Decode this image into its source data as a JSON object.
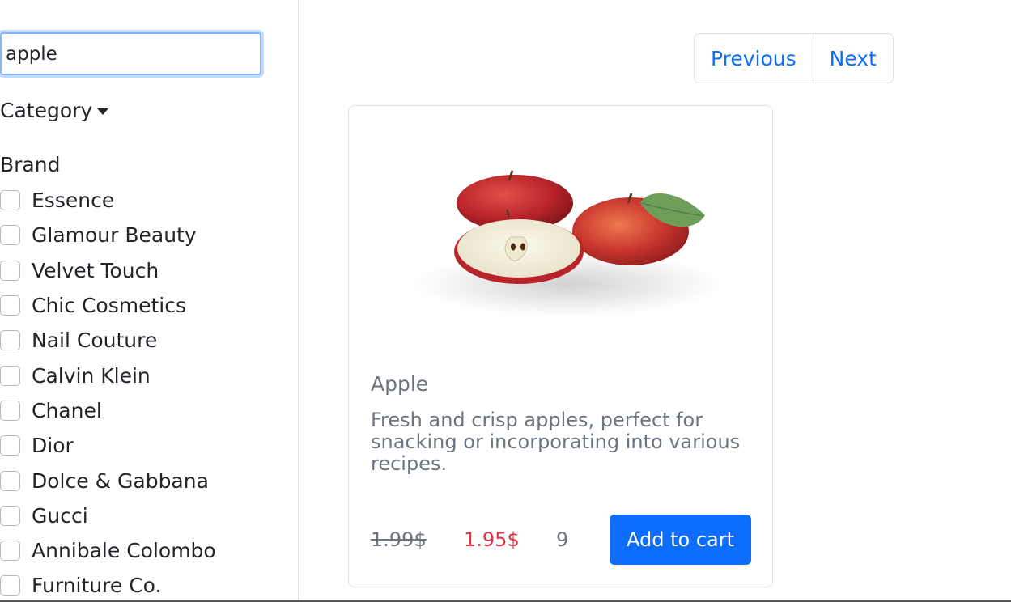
{
  "search": {
    "value": "apple"
  },
  "filters": {
    "category_label": "Category",
    "brand_heading": "Brand",
    "brands": [
      "Essence",
      "Glamour Beauty",
      "Velvet Touch",
      "Chic Cosmetics",
      "Nail Couture",
      "Calvin Klein",
      "Chanel",
      "Dior",
      "Dolce & Gabbana",
      "Gucci",
      "Annibale Colombo",
      "Furniture Co."
    ]
  },
  "pagination": {
    "previous_label": "Previous",
    "next_label": "Next"
  },
  "product": {
    "title": "Apple",
    "description": "Fresh and crisp apples, perfect for snacking or incorporating into various recipes.",
    "original_price": "1.99$",
    "discounted_price": "1.95$",
    "stock": "9",
    "add_to_cart_label": "Add to cart",
    "image_icon": "apple-product-image"
  },
  "colors": {
    "primary": "#0d6efd",
    "danger": "#dc3545",
    "muted": "#6c757d"
  }
}
